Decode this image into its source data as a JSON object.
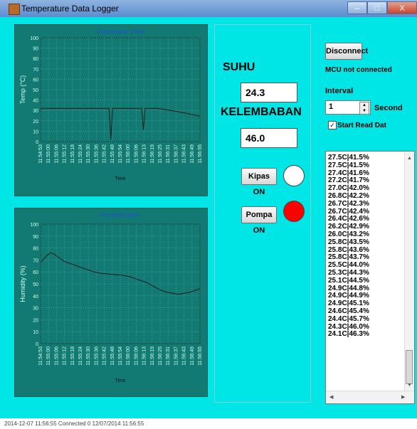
{
  "window": {
    "title": "Temperature Data Logger",
    "minimize_glyph": "–",
    "maximize_glyph": "□",
    "close_glyph": "X"
  },
  "temperature_chart": {
    "chart_data": {
      "type": "line",
      "title": "Temperature Chart",
      "xlabel": "Time",
      "ylabel": "Temp (°C)",
      "ylim": [
        0,
        100
      ],
      "yticks": [
        0,
        10,
        20,
        30,
        40,
        50,
        60,
        70,
        80,
        90,
        100
      ],
      "x_ticks": [
        "11:54:53",
        "11:55:00",
        "11:55:06",
        "11:55:12",
        "11:55:18",
        "11:55:24",
        "11:55:30",
        "11:55:36",
        "11:55:42",
        "11:55:48",
        "11:55:54",
        "11:56:00",
        "11:56:06",
        "11:56:13",
        "11:56:19",
        "11:56:25",
        "11:56:31",
        "11:56:37",
        "11:56:43",
        "11:56:49",
        "11:56:55"
      ],
      "series": [
        {
          "values": [
            31,
            32,
            32,
            32,
            32,
            32,
            32,
            32,
            32,
            32,
            32,
            32,
            32,
            32,
            32,
            32,
            32,
            32,
            32,
            32,
            32,
            32,
            32,
            32,
            32,
            32,
            32,
            32,
            32,
            32,
            32,
            32,
            32,
            32,
            32,
            32,
            32,
            32,
            32,
            32,
            32,
            2,
            32,
            32,
            32,
            32,
            32,
            32,
            32,
            32,
            32,
            32,
            32,
            32,
            32,
            32,
            32,
            32,
            32,
            32,
            11,
            32,
            32,
            32,
            32,
            32,
            32,
            32,
            32,
            31.8,
            31.5,
            31.3,
            31,
            30.8,
            30.5,
            30.2,
            30,
            29.7,
            29.4,
            29.1,
            28.8,
            28.5,
            28.2,
            27.9,
            27.5,
            27.2,
            26.9,
            26.6,
            26.2,
            25.8,
            25.5,
            25.1,
            24.7,
            24.3
          ]
        }
      ],
      "grid": true
    }
  },
  "humidity_chart": {
    "chart_data": {
      "type": "line",
      "title": "Humidity Chart",
      "xlabel": "Time",
      "ylabel": "Humidity (%)",
      "ylim": [
        0,
        100
      ],
      "yticks": [
        0,
        10,
        20,
        30,
        40,
        50,
        60,
        70,
        80,
        90,
        100
      ],
      "x_ticks": [
        "11:54:53",
        "11:55:00",
        "11:55:06",
        "11:55:12",
        "11:55:18",
        "11:55:24",
        "11:55:30",
        "11:55:36",
        "11:55:42",
        "11:55:48",
        "11:55:54",
        "11:56:00",
        "11:56:06",
        "11:56:13",
        "11:56:19",
        "11:56:25",
        "11:56:31",
        "11:56:37",
        "11:56:43",
        "11:56:49",
        "11:56:55"
      ],
      "series": [
        {
          "values": [
            68,
            71,
            74,
            76,
            75,
            73,
            71,
            69,
            68,
            67,
            66,
            65,
            64,
            63,
            62,
            61,
            60,
            59.5,
            59,
            58.5,
            58.5,
            58,
            58,
            57.5,
            57.5,
            57,
            56.5,
            56,
            55,
            54,
            53,
            52,
            51,
            49.5,
            48,
            46.5,
            45,
            44,
            43,
            42.5,
            42,
            41.5,
            41.5,
            42,
            42.5,
            43,
            44,
            45,
            46
          ]
        }
      ],
      "grid": true
    }
  },
  "readings": {
    "suhu_label": "SUHU",
    "suhu_value": "24.3",
    "kelembaban_label": "KELEMBABAN",
    "kelembaban_value": "46.0"
  },
  "actuators": {
    "kipas_label": "Kipas ON",
    "kipas_color": "#ffffff",
    "pompa_label": "Pompa ON",
    "pompa_color": "#ff0000"
  },
  "connection": {
    "disconnect_label": "Disconnect",
    "status_text": "MCU not connected",
    "interval_label": "Interval",
    "interval_value": "1",
    "second_label": "Second",
    "start_read_label": "Start Read Dat",
    "start_read_checked": true
  },
  "log_items": [
    "27.5C|41.5%",
    "27.5C|41.5%",
    "27.4C|41.6%",
    "27.2C|41.7%",
    "27.0C|42.0%",
    "26.8C|42.2%",
    "26.7C|42.3%",
    "26.7C|42.4%",
    "26.4C|42.6%",
    "26.2C|42.9%",
    "26.0C|43.2%",
    "25.8C|43.5%",
    "25.8C|43.6%",
    "25.8C|43.7%",
    "25.5C|44.0%",
    "25.3C|44.3%",
    "25.1C|44.5%",
    "24.9C|44.8%",
    "24.9C|44.9%",
    "24.9C|45.1%",
    "24.6C|45.4%",
    "24.4C|45.7%",
    "24.3C|46.0%",
    "24.1C|46.3%"
  ],
  "statusbar": {
    "text": "2014-12-07 11:56:55      Connected 0  12/07/2014 11:56:55"
  },
  "colors": {
    "client_bg": "#00e6e6",
    "chart_bg": "#127a72",
    "plot_line": "#1a1a1a",
    "chart_title": "#1f4fd8"
  }
}
